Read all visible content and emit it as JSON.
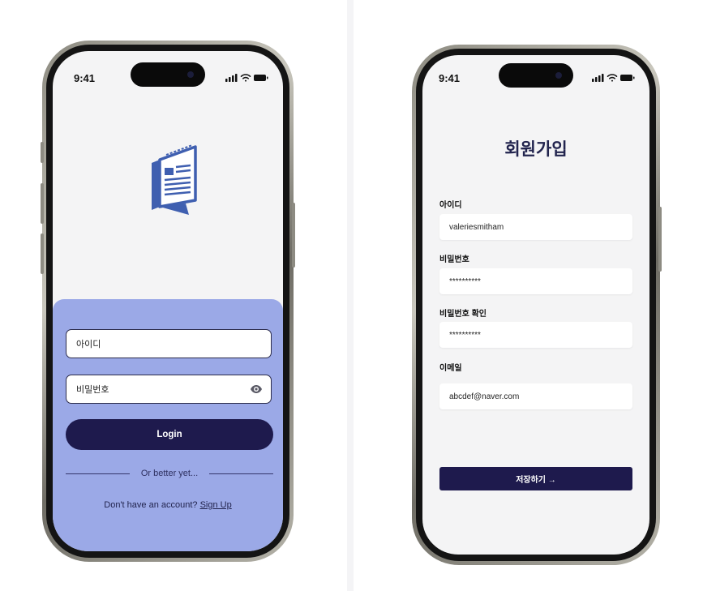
{
  "colors": {
    "brand_navy": "#1e1a4d",
    "login_panel": "#9ba9e7",
    "logo_blue": "#3f5fb0",
    "screen_bg": "#f4f4f5"
  },
  "login_screen": {
    "status_time": "9:41",
    "logo_icon": "newspaper-icon",
    "username_placeholder": "아이디",
    "password_placeholder": "비밀번호",
    "password_toggle_icon": "eye-icon",
    "login_label": "Login",
    "divider_text": "Or better yet...",
    "no_account_text": "Don't have an account? ",
    "signup_link": "Sign Up"
  },
  "signup_screen": {
    "status_time": "9:41",
    "title": "회원가입",
    "fields": [
      {
        "label": "아이디",
        "value": "valeriesmitham"
      },
      {
        "label": "비밀번호",
        "value": "**********"
      },
      {
        "label": "비밀번호 확인",
        "value": "**********"
      },
      {
        "label": "이메일",
        "value": "abcdef@naver.com"
      }
    ],
    "save_label": "저장하기 →"
  }
}
